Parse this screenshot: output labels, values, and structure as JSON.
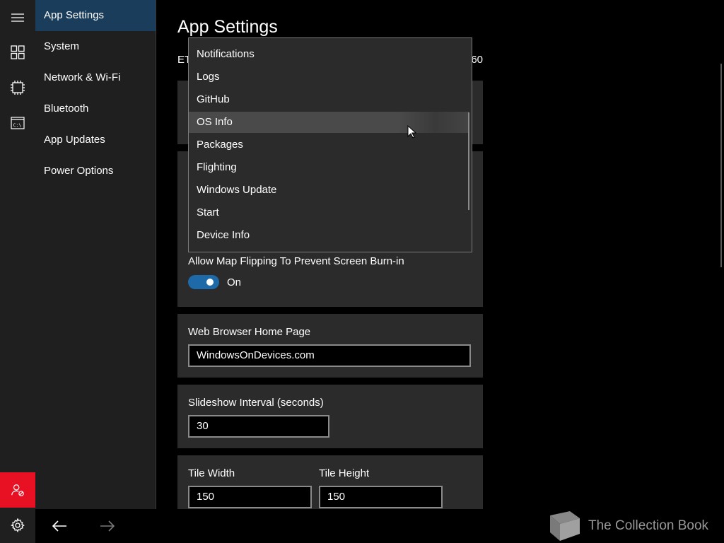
{
  "nav": {
    "items": [
      {
        "label": "App Settings",
        "active": true
      },
      {
        "label": "System",
        "active": false
      },
      {
        "label": "Network & Wi-Fi",
        "active": false
      },
      {
        "label": "Bluetooth",
        "active": false
      },
      {
        "label": "App Updates",
        "active": false
      },
      {
        "label": "Power Options",
        "active": false
      }
    ]
  },
  "rail": {
    "icons": [
      "hamburger-menu-icon",
      "dashboard-grid-icon",
      "chip-icon",
      "command-prompt-icon",
      "user-block-icon",
      "gear-icon"
    ],
    "user_button_color": "#e81123"
  },
  "main": {
    "title": "App Settings",
    "subline_left": "ET",
    "subline_right": "60",
    "map_flip": {
      "label": "Allow Map Flipping To Prevent Screen Burn-in",
      "state_text": "On",
      "on": true
    },
    "home_page": {
      "label": "Web Browser Home Page",
      "value": "WindowsOnDevices.com"
    },
    "slideshow": {
      "label": "Slideshow Interval (seconds)",
      "value": "30"
    },
    "tile": {
      "width_label": "Tile Width",
      "width_value": "150",
      "height_label": "Tile Height",
      "height_value": "150"
    }
  },
  "dropdown": {
    "options": [
      "Notifications",
      "Logs",
      "GitHub",
      "OS Info",
      "Packages",
      "Flighting",
      "Windows Update",
      "Start",
      "Device Info"
    ],
    "hovered": "OS Info"
  },
  "watermark": {
    "text": "The Collection Book"
  },
  "colors": {
    "accent": "#1e6aa8",
    "nav_active": "#1a3d5c",
    "card_bg": "#2b2b2b"
  }
}
